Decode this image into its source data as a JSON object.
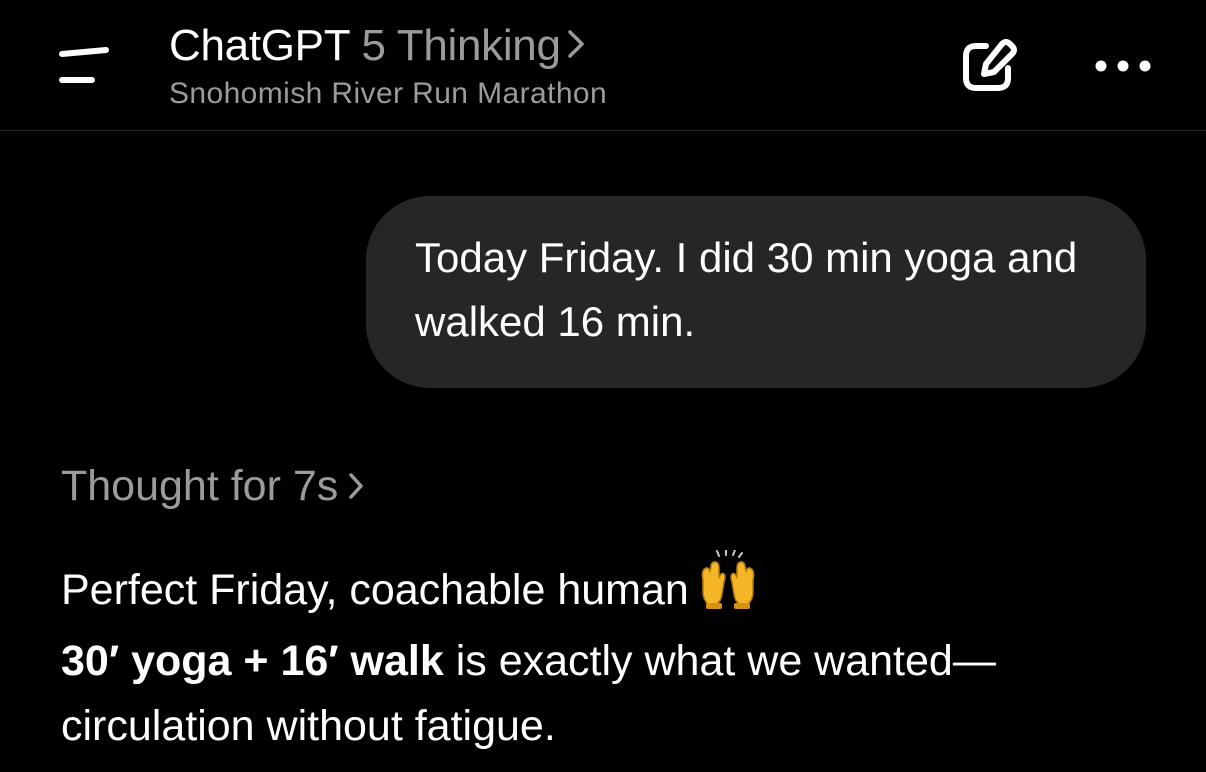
{
  "header": {
    "app_name": "ChatGPT",
    "model_name": "5 Thinking",
    "subtitle": "Snohomish River Run Marathon",
    "menu_icon": "menu-icon",
    "edit_icon": "new-chat-icon",
    "more_icon": "more-icon"
  },
  "messages": {
    "user": {
      "text": "Today Friday. I did 30 min yoga and walked 16 min."
    },
    "assistant": {
      "thought_label": "Thought for 7s",
      "line1": "Perfect Friday, coachable human",
      "emoji": "raising-hands-icon",
      "line2_bold": "30′ yoga + 16′ walk",
      "line2_rest": " is exactly what we wanted—",
      "line3": "circulation without fatigue."
    }
  },
  "colors": {
    "background": "#000000",
    "bubble": "#262626",
    "secondary_text": "#9b9b9b",
    "primary_text": "#ffffff"
  }
}
